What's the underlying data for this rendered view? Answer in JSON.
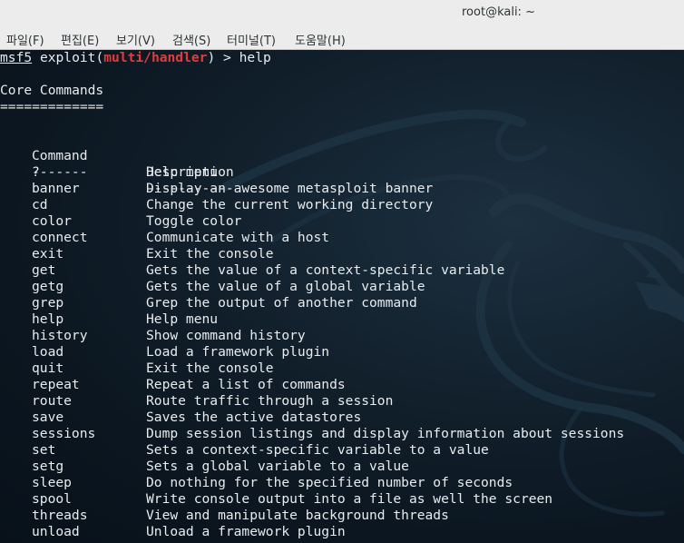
{
  "window": {
    "title": "root@kali: ~"
  },
  "menubar": {
    "items": [
      "파일(F)",
      "편집(E)",
      "보기(V)",
      "검색(S)",
      "터미널(T)",
      "도움말(H)"
    ]
  },
  "terminal": {
    "prompt": {
      "msf": "msf5",
      "exploit_open": " exploit(",
      "module": "multi/handler",
      "close": ") > ",
      "command": "help"
    },
    "section_title": "Core Commands",
    "section_underline": "=============",
    "header": {
      "command": "Command",
      "description": "Description"
    },
    "header_underline": {
      "command": "-------",
      "description": "-----------"
    },
    "rows": [
      {
        "command": "?",
        "description": "Help menu"
      },
      {
        "command": "banner",
        "description": "Display an awesome metasploit banner"
      },
      {
        "command": "cd",
        "description": "Change the current working directory"
      },
      {
        "command": "color",
        "description": "Toggle color"
      },
      {
        "command": "connect",
        "description": "Communicate with a host"
      },
      {
        "command": "exit",
        "description": "Exit the console"
      },
      {
        "command": "get",
        "description": "Gets the value of a context-specific variable"
      },
      {
        "command": "getg",
        "description": "Gets the value of a global variable"
      },
      {
        "command": "grep",
        "description": "Grep the output of another command"
      },
      {
        "command": "help",
        "description": "Help menu"
      },
      {
        "command": "history",
        "description": "Show command history"
      },
      {
        "command": "load",
        "description": "Load a framework plugin"
      },
      {
        "command": "quit",
        "description": "Exit the console"
      },
      {
        "command": "repeat",
        "description": "Repeat a list of commands"
      },
      {
        "command": "route",
        "description": "Route traffic through a session"
      },
      {
        "command": "save",
        "description": "Saves the active datastores"
      },
      {
        "command": "sessions",
        "description": "Dump session listings and display information about sessions"
      },
      {
        "command": "set",
        "description": "Sets a context-specific variable to a value"
      },
      {
        "command": "setg",
        "description": "Sets a global variable to a value"
      },
      {
        "command": "sleep",
        "description": "Do nothing for the specified number of seconds"
      },
      {
        "command": "spool",
        "description": "Write console output into a file as well the screen"
      },
      {
        "command": "threads",
        "description": "View and manipulate background threads"
      },
      {
        "command": "unload",
        "description": "Unload a framework plugin"
      }
    ]
  },
  "colors": {
    "module_red": "#e23c3c",
    "terminal_text": "#e8ecef",
    "background": "#0b1620"
  }
}
